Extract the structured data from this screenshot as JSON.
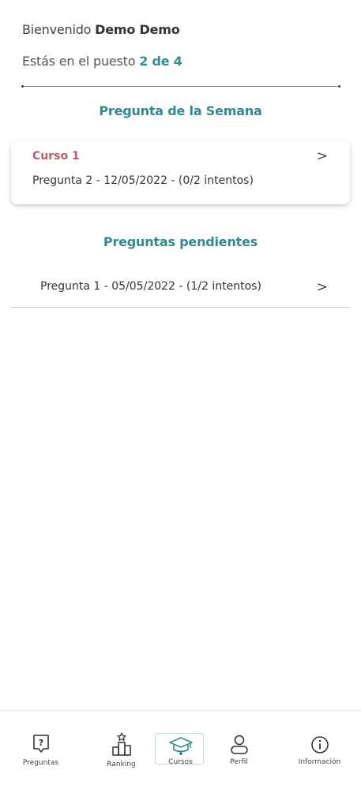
{
  "header": {
    "welcome_prefix": "Bienvenido ",
    "user_name": "Demo Demo",
    "rank_prefix": "Estás en el puesto ",
    "rank_value": "2 de 4"
  },
  "weekly": {
    "title": "Pregunta de la Semana",
    "course": "Curso 1",
    "question": "Pregunta 2 -  12/05/2022 -  (0/2 intentos)",
    "chevron": ">"
  },
  "pending": {
    "title": "Preguntas pendientes",
    "items": [
      {
        "text": "Pregunta 1 -  05/05/2022 -  (1/2 intentos)",
        "chevron": ">"
      }
    ]
  },
  "tabs": [
    {
      "label": "Preguntas",
      "icon": "question-icon"
    },
    {
      "label": "Ranking",
      "icon": "ranking-icon"
    },
    {
      "label": "Cursos",
      "icon": "graduation-cap-icon",
      "active": true
    },
    {
      "label": "Perfil",
      "icon": "user-icon"
    },
    {
      "label": "Información",
      "icon": "info-icon"
    }
  ],
  "colors": {
    "accent": "#2e8b8e",
    "course": "#c0586b",
    "text": "#333333"
  }
}
